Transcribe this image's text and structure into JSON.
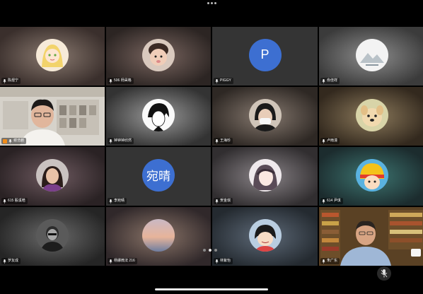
{
  "colors": {
    "accent_blue": "#3d6fd1",
    "active_green": "#2fd16a"
  },
  "tiles": [
    {
      "name": "陈煜宁",
      "avatar": "anime-girl-avatar"
    },
    {
      "name": "506 杨昊格",
      "avatar": "baby-photo-avatar"
    },
    {
      "name": "PIGGY",
      "avatar_text": "P"
    },
    {
      "name": "俞佳祥",
      "avatar": "mountain-avatar"
    },
    {
      "name": "谢浩鹏",
      "video": "man-glasses-video"
    },
    {
      "name": "钟钟钟欣然",
      "avatar": "anime-boy-avatar"
    },
    {
      "name": "王海珍",
      "avatar": "masked-person-avatar"
    },
    {
      "name": "卢雨潼",
      "avatar": "puppy-avatar"
    },
    {
      "name": "615 殷溪皓",
      "avatar": "woman-photo-avatar"
    },
    {
      "name": "李宛晴",
      "avatar_text": "宛晴"
    },
    {
      "name": "贺金琪",
      "avatar": "anime-girl-avatar-2"
    },
    {
      "name": "614 尹琪",
      "avatar": "cartoon-helmet-avatar"
    },
    {
      "name": "罗友成",
      "avatar": "bw-photo-avatar"
    },
    {
      "name": "杨娜微法 216",
      "avatar": "sunset-avatar"
    },
    {
      "name": "林紫怡",
      "avatar": "cartoon-girl-avatar"
    },
    {
      "name": "朱广东",
      "video": "teacher-video"
    }
  ]
}
